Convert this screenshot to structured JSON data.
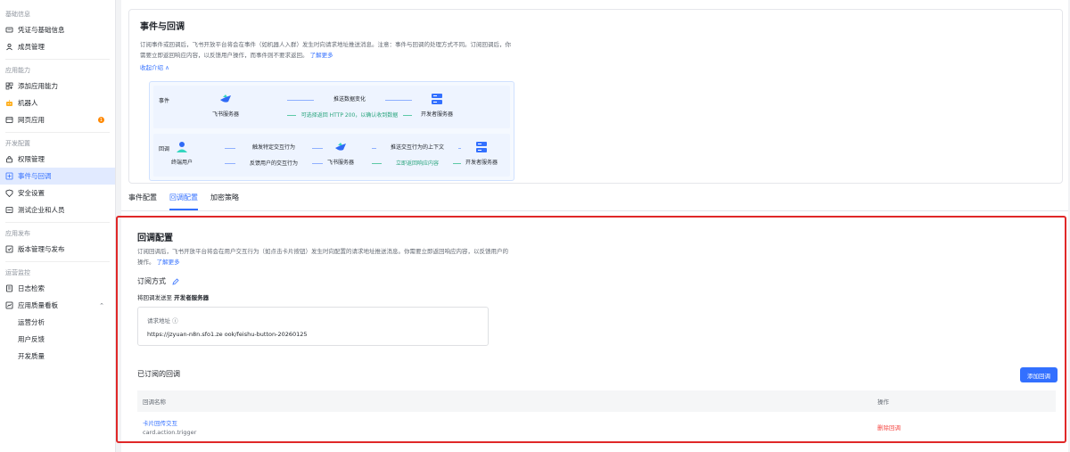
{
  "sidebar": {
    "sections": [
      {
        "title": "基础信息",
        "items": [
          {
            "label": "凭证与基础信息",
            "icon": "credential-icon"
          },
          {
            "label": "成员管理",
            "icon": "member-icon"
          }
        ]
      },
      {
        "title": "应用能力",
        "items": [
          {
            "label": "添加应用能力",
            "icon": "add-capability-icon"
          },
          {
            "label": "机器人",
            "icon": "robot-icon"
          },
          {
            "label": "网页应用",
            "icon": "web-app-icon",
            "badge": "1"
          }
        ]
      },
      {
        "title": "开发配置",
        "items": [
          {
            "label": "权限管理",
            "icon": "permission-icon"
          },
          {
            "label": "事件与回调",
            "icon": "event-callback-icon",
            "active": true
          },
          {
            "label": "安全设置",
            "icon": "security-icon"
          },
          {
            "label": "测试企业和人员",
            "icon": "test-enterprise-icon"
          }
        ]
      },
      {
        "title": "应用发布",
        "items": [
          {
            "label": "版本管理与发布",
            "icon": "version-icon"
          }
        ]
      },
      {
        "title": "运营监控",
        "items": [
          {
            "label": "日志检索",
            "icon": "log-icon"
          },
          {
            "label": "应用质量看板",
            "icon": "quality-icon",
            "expandable": true
          },
          {
            "label": "运营分析",
            "sub": true
          },
          {
            "label": "用户反馈",
            "sub": true
          },
          {
            "label": "开发质量",
            "sub": true
          }
        ]
      }
    ]
  },
  "intro": {
    "title": "事件与回调",
    "desc": "订阅事件或回调后，飞书开放平台将会在事件（如机器人入群）发生时向请求地址推送消息。注意：事件与回调的处理方式不同。订阅回调后，你需要立即返回响应内容，以反馈用户操作，而事件则不要求返回。",
    "learn_more": "了解更多",
    "collapse": "收起介绍 ∧",
    "event_row": {
      "tag": "事件",
      "from": "飞书服务器",
      "to": "开发者服务器",
      "top_label": "推送数据变化",
      "bottom_label": "可选择返回 HTTP 200，以确认收到数据"
    },
    "callback_row": {
      "tag": "回调",
      "user": "终端用户",
      "middle": "飞书服务器",
      "to": "开发者服务器",
      "l_top": "触发特定交互行为",
      "l_bottom": "反馈用户的交互行为",
      "r_top": "推送交互行为的上下文",
      "r_bottom": "立即返回响应内容"
    }
  },
  "tabs": [
    "事件配置",
    "回调配置",
    "加密策略"
  ],
  "active_tab": 1,
  "callback": {
    "title": "回调配置",
    "desc": "订阅回调后，飞书开放平台将会在用户交互行为（如点击卡片按钮）发生时向配置的请求地址推送消息。你需要立即返回响应内容，以反馈用户的操作。",
    "learn_more": "了解更多",
    "subscribe_mode": "订阅方式",
    "send_to_prefix": "将回调发送至",
    "send_to_target": "开发者服务器",
    "url_label": "请求地址 ⓘ",
    "url_value": "https://jzyuan-n8n.sfo1.ze                    ook/feishu-button-20260125",
    "subscribed_title": "已订阅的回调",
    "add_button": "添加回调",
    "columns": [
      "回调名称",
      "操作"
    ],
    "rows": [
      {
        "name": "卡片回传交互",
        "key": "card.action.trigger",
        "action": "删除回调"
      }
    ]
  }
}
